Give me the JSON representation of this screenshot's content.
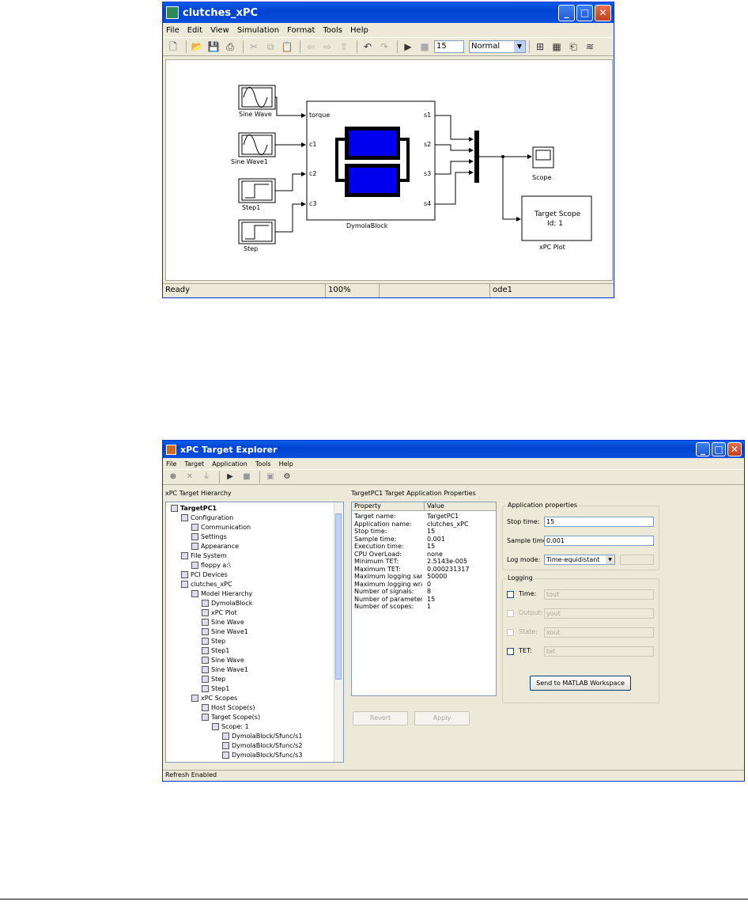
{
  "simulink": {
    "title": "clutches_xPC",
    "menu": [
      "File",
      "Edit",
      "View",
      "Simulation",
      "Format",
      "Tools",
      "Help"
    ],
    "stop_time": "15",
    "mode": "Normal",
    "blocks": {
      "sine_wave": "Sine Wave",
      "sine_wave1": "Sine Wave1",
      "step1": "Step1",
      "step": "Step",
      "dymola": "DymolaBlock",
      "in_ports": [
        "torque",
        "c1",
        "c2",
        "c3"
      ],
      "out_ports": [
        "s1",
        "s2",
        "s3",
        "s4"
      ],
      "scope": "Scope",
      "xpc_plot": "xPC Plot",
      "target_scope_line1": "Target Scope",
      "target_scope_line2": "Id: 1"
    },
    "status": {
      "state": "Ready",
      "zoom": "100%",
      "solver": "ode1"
    }
  },
  "explorer": {
    "title": "xPC Target Explorer",
    "menu": [
      "File",
      "Target",
      "Application",
      "Tools",
      "Help"
    ],
    "left_header": "xPC Target Hierarchy",
    "right_header": "TargetPC1 Target Application Properties",
    "tree": [
      {
        "label": "TargetPC1",
        "indent": 0,
        "bold": true
      },
      {
        "label": "Configuration",
        "indent": 1
      },
      {
        "label": "Communication",
        "indent": 2
      },
      {
        "label": "Settings",
        "indent": 2
      },
      {
        "label": "Appearance",
        "indent": 2
      },
      {
        "label": "File System",
        "indent": 1
      },
      {
        "label": "floppy a:\\",
        "indent": 2
      },
      {
        "label": "PCI Devices",
        "indent": 1
      },
      {
        "label": "clutches_xPC",
        "indent": 1
      },
      {
        "label": "Model Hierarchy",
        "indent": 2
      },
      {
        "label": "DymolaBlock",
        "indent": 3
      },
      {
        "label": "xPC Plot",
        "indent": 3
      },
      {
        "label": "Sine Wave",
        "indent": 3
      },
      {
        "label": "Sine Wave1",
        "indent": 3
      },
      {
        "label": "Step",
        "indent": 3
      },
      {
        "label": "Step1",
        "indent": 3
      },
      {
        "label": "Sine Wave",
        "indent": 3
      },
      {
        "label": "Sine Wave1",
        "indent": 3
      },
      {
        "label": "Step",
        "indent": 3
      },
      {
        "label": "Step1",
        "indent": 3
      },
      {
        "label": "xPC Scopes",
        "indent": 2
      },
      {
        "label": "Host Scope(s)",
        "indent": 3
      },
      {
        "label": "Target Scope(s)",
        "indent": 3
      },
      {
        "label": "Scope: 1",
        "indent": 4
      },
      {
        "label": "DymolaBlock/Sfunc/s1",
        "indent": 5
      },
      {
        "label": "DymolaBlock/Sfunc/s2",
        "indent": 5
      },
      {
        "label": "DymolaBlock/Sfunc/s3",
        "indent": 5
      }
    ],
    "prop_headers": [
      "Property",
      "Value"
    ],
    "props": [
      [
        "Target name:",
        "TargetPC1"
      ],
      [
        "Application name:",
        "clutches_xPC"
      ],
      [
        "Stop time:",
        "15"
      ],
      [
        "Sample time:",
        "0.001"
      ],
      [
        "Execution time:",
        "15"
      ],
      [
        "CPU OverLoad:",
        "none"
      ],
      [
        "Minimum TET:",
        "2.5143e-005"
      ],
      [
        "Maximum TET:",
        "0.000231317"
      ],
      [
        "Maximum logging samp...",
        "50000"
      ],
      [
        "Maximum logging wraps:",
        "0"
      ],
      [
        "Number of signals:",
        "8"
      ],
      [
        "Number of parameters:",
        "15"
      ],
      [
        "Number of scopes:",
        "1"
      ]
    ],
    "app_props": {
      "group": "Application properties",
      "stop_label": "Stop time:",
      "stop_value": "15",
      "sample_label": "Sample time:",
      "sample_value": "0.001",
      "log_label": "Log mode:",
      "log_value": "Time-equidistant"
    },
    "logging": {
      "group": "Logging",
      "rows": [
        {
          "label": "Time:",
          "value": "tout"
        },
        {
          "label": "Output:",
          "value": "yout"
        },
        {
          "label": "State:",
          "value": "xout"
        },
        {
          "label": "TET:",
          "value": "tet"
        }
      ],
      "send_button": "Send to MATLAB Workspace"
    },
    "revert": "Revert",
    "apply": "Apply",
    "status": "Refresh Enabled"
  }
}
